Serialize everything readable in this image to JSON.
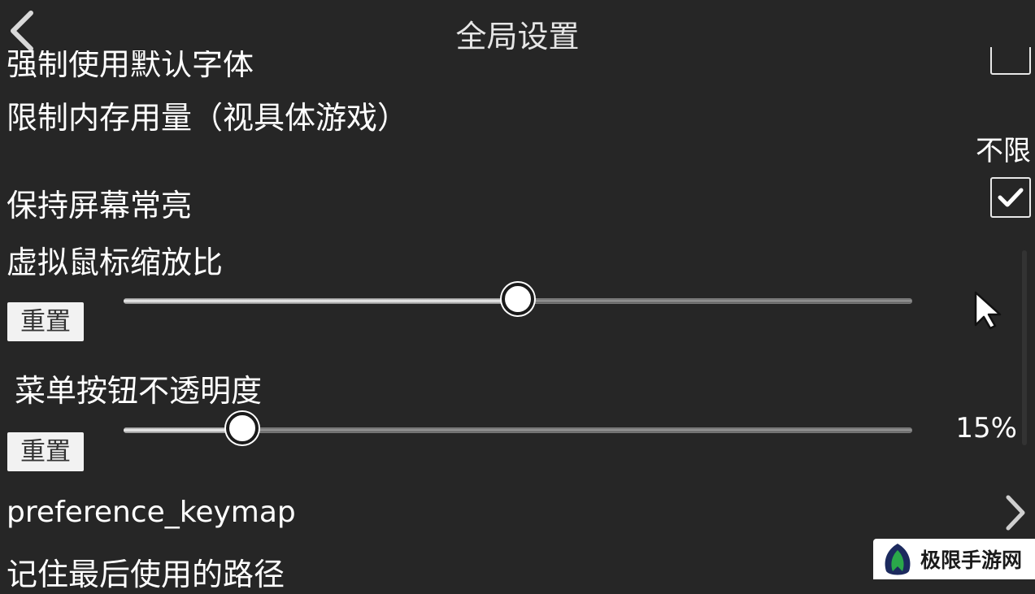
{
  "header": {
    "title": "全局设置"
  },
  "settings": {
    "force_default_font": {
      "label": "强制使用默认字体",
      "checked": false
    },
    "memory_limit": {
      "label": "限制内存用量（视具体游戏）",
      "value": "不限"
    },
    "keep_screen_on": {
      "label": "保持屏幕常亮",
      "checked": true
    },
    "virtual_mouse_scale": {
      "label": "虚拟鼠标缩放比",
      "reset_label": "重置",
      "fraction": 0.5
    },
    "menu_button_opacity": {
      "label": "菜单按钮不透明度",
      "reset_label": "重置",
      "value": "15%",
      "fraction": 0.15
    },
    "preference_keymap": {
      "label": "preference_keymap"
    },
    "remember_last_path": {
      "label": "记住最后使用的路径"
    }
  },
  "watermark": {
    "text": "极限手游网"
  },
  "icons": {
    "back": "back-chevron-icon",
    "cursor": "mouse-pointer-icon",
    "chevron": "chevron-right-icon",
    "check": "check-icon",
    "logo": "leaf-logo-icon"
  },
  "colors": {
    "background": "#262626",
    "text": "#ffffff",
    "button": "#f2f2f2",
    "logo_green": "#2aa84a",
    "logo_navy": "#1c2a5e"
  }
}
